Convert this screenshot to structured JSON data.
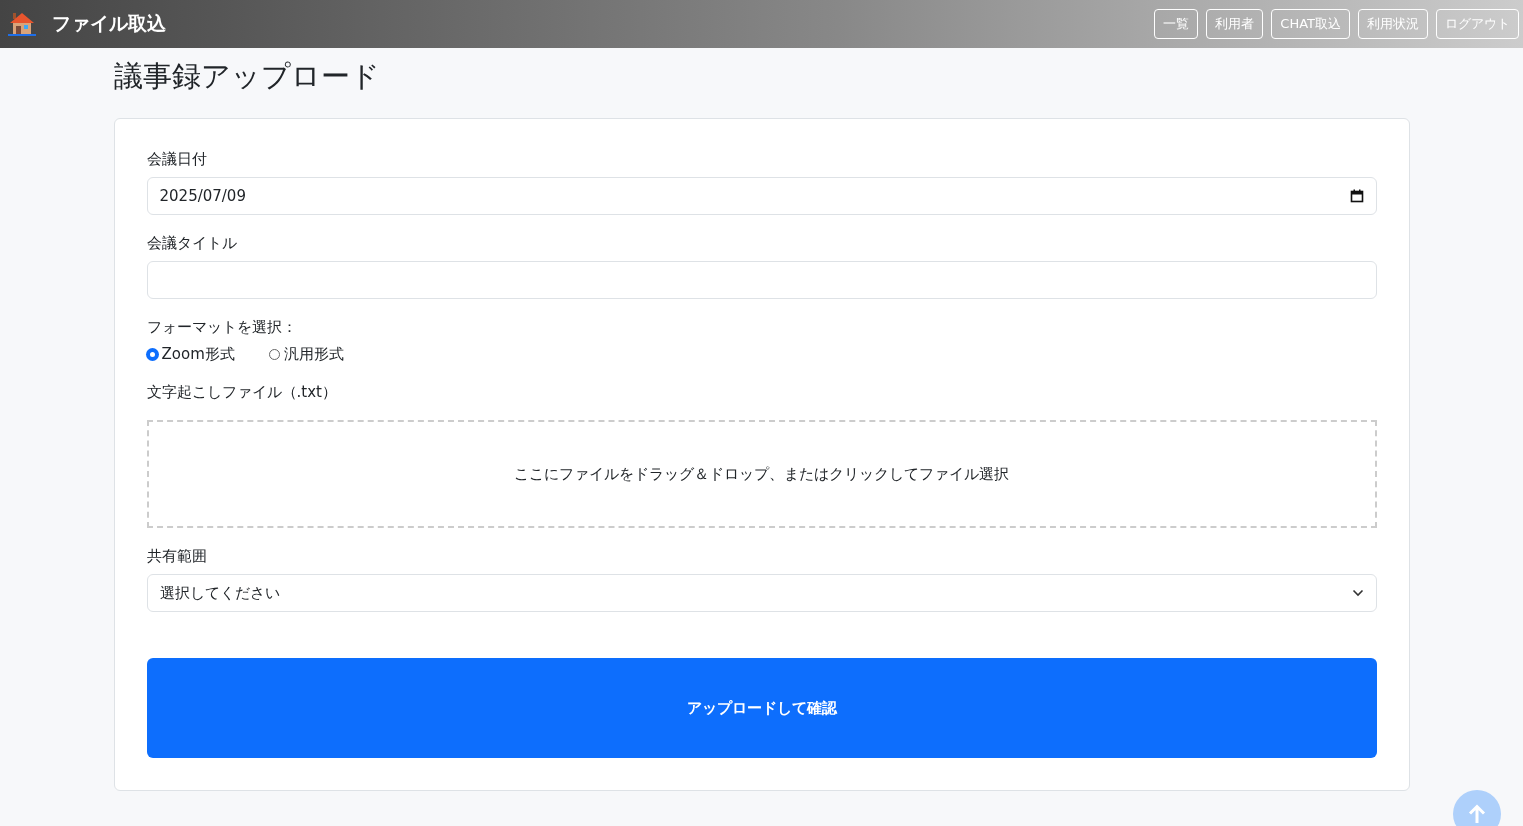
{
  "header": {
    "title": "ファイル取込",
    "nav": [
      {
        "label": "一覧"
      },
      {
        "label": "利用者"
      },
      {
        "label": "CHAT取込"
      },
      {
        "label": "利用状況"
      },
      {
        "label": "ログアウト"
      }
    ]
  },
  "page_title": "議事録アップロード",
  "form": {
    "date": {
      "label": "会議日付",
      "value": "2025/07/09"
    },
    "title": {
      "label": "会議タイトル"
    },
    "format": {
      "label": "フォーマットを選択：",
      "options": [
        {
          "label": "Zoom形式",
          "selected": true
        },
        {
          "label": "汎用形式",
          "selected": false
        }
      ]
    },
    "file": {
      "label": "文字起こしファイル（.txt）",
      "dropzone": "ここにファイルをドラッグ＆ドロップ、またはクリックしてファイル選択"
    },
    "scope": {
      "label": "共有範囲",
      "value": "選択してください"
    },
    "submit": "アップロードして確認"
  }
}
